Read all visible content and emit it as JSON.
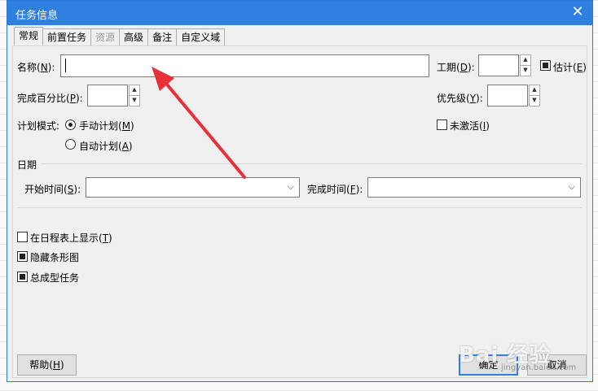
{
  "window": {
    "title": "任务信息",
    "close_glyph": "✕"
  },
  "tabs": [
    {
      "label": "常规",
      "active": true
    },
    {
      "label": "前置任务"
    },
    {
      "label": "资源",
      "disabled": true
    },
    {
      "label": "高级"
    },
    {
      "label": "备注"
    },
    {
      "label": "自定义域"
    }
  ],
  "general": {
    "name_label": "名称(",
    "name_key": "N",
    "name_suffix": "):",
    "name_value": "",
    "duration_label": "工期(",
    "duration_key": "D",
    "duration_suffix": "):",
    "estimated_label": "估计(",
    "estimated_key": "E",
    "estimated_suffix": ")",
    "estimated_checked": true,
    "percent_label": "完成百分比(",
    "percent_key": "P",
    "percent_suffix": "):",
    "priority_label": "优先级(",
    "priority_key": "Y",
    "priority_suffix": "):",
    "schedule_mode_label": "计划模式:",
    "manual_label": "手动计划(",
    "manual_key": "M",
    "manual_suffix": ")",
    "auto_label": "自动计划(",
    "auto_key": "A",
    "auto_suffix": ")",
    "inactive_label": "未激活(",
    "inactive_key": "I",
    "inactive_suffix": ")",
    "dates_group_label": "日期",
    "start_label": "开始时间(",
    "start_key": "S",
    "start_suffix": "):",
    "finish_label": "完成时间(",
    "finish_key": "F",
    "finish_suffix": "):",
    "timeline_label": "在日程表上显示(",
    "timeline_key": "T",
    "timeline_suffix": ")",
    "hide_bar_label": "隐藏条形图",
    "summary_label": "总成型任务"
  },
  "buttons": {
    "help_label": "帮助(",
    "help_key": "H",
    "help_suffix": ")",
    "ok_label": "确定",
    "cancel_label": "取消"
  },
  "icons": {
    "spin_up": "▲",
    "spin_down": "▼",
    "combo_arrow": "⌵"
  },
  "watermark": {
    "text": "Bai 经验",
    "sub": "jingyan.baidu.com"
  },
  "colors": {
    "titlebar": "#2f7fe0",
    "annotation_arrow": "#e8303a"
  }
}
